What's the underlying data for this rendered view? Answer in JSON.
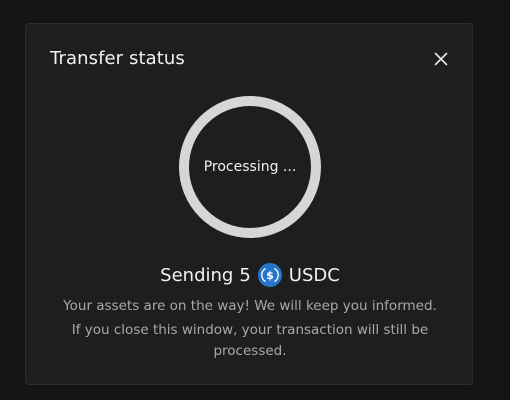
{
  "modal": {
    "title": "Transfer status",
    "close_icon": "close-icon",
    "progress": {
      "label": "Processing ..."
    },
    "sending": {
      "prefix": "Sending",
      "amount": "5",
      "token_icon": "usdc-icon",
      "token": "USDC"
    },
    "messages": {
      "line1": "Your assets are on the way! We will keep you informed.",
      "line2": "If you close this window, your transaction will still be processed."
    }
  },
  "colors": {
    "background": "#141414",
    "modal_bg": "#1e1e1e",
    "ring": "#d6d6d6",
    "usdc_blue": "#2775ca",
    "text_primary": "#f2f2f2",
    "text_secondary": "#a8a8a8"
  }
}
